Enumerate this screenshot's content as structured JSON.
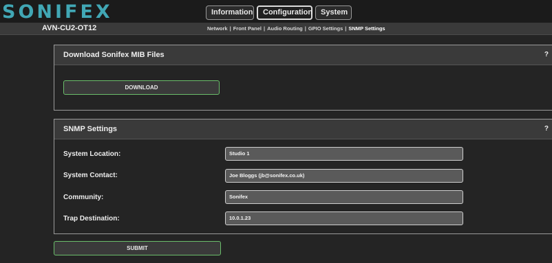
{
  "brand": {
    "logo": "SONIFEX"
  },
  "tabs": [
    {
      "label": "Information"
    },
    {
      "label": "Configuration"
    },
    {
      "label": "System"
    }
  ],
  "device_name": "AVN-CU2-OT12",
  "subnav": [
    {
      "label": "Network"
    },
    {
      "label": "Front Panel"
    },
    {
      "label": "Audio Routing"
    },
    {
      "label": "GPIO Settings"
    },
    {
      "label": "SNMP Settings"
    }
  ],
  "mib_panel": {
    "title": "Download Sonifex MIB Files",
    "help": "?",
    "download_label": "DOWNLOAD"
  },
  "snmp_panel": {
    "title": "SNMP Settings",
    "help": "?",
    "fields": [
      {
        "label": "System Location:",
        "value": "Studio 1"
      },
      {
        "label": "System Contact:",
        "value": "Joe Bloggs (jb@sonifex.co.uk)"
      },
      {
        "label": "Community:",
        "value": "Sonifex"
      },
      {
        "label": "Trap Destination:",
        "value": "10.0.1.23"
      }
    ]
  },
  "submit_label": "SUBMIT",
  "colors": {
    "logo": "#41a7b5",
    "button_border": "#6bbf6b",
    "background": "#242424"
  }
}
